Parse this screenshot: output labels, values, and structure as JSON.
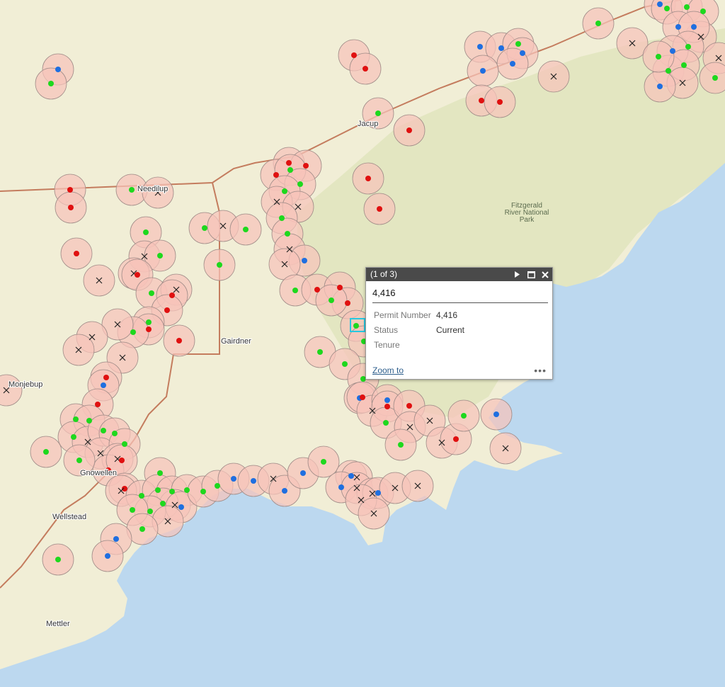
{
  "map": {
    "place_labels": [
      "Jacup",
      "Needilup",
      "Gairdner",
      "Monjebup",
      "Gnowellen",
      "Wellstead",
      "Mettler"
    ],
    "park_label_lines": [
      "Fitzgerald",
      "River National",
      "Park"
    ],
    "marker_colors": {
      "green": "#1ed81e",
      "blue": "#1f6fe0",
      "red": "#e01010",
      "cross": "#222222",
      "buffer_fill": "#f6c4ba",
      "road": "#c47c5e",
      "ocean": "#bcd8ef",
      "land": "#f1eed6",
      "park": "#e3e6c1"
    }
  },
  "popup": {
    "counter": "(1 of 3)",
    "title": "4,416",
    "fields": [
      {
        "name": "Permit Number",
        "value": "4,416"
      },
      {
        "name": "Status",
        "value": "Current"
      },
      {
        "name": "Tenure",
        "value": ""
      }
    ],
    "zoom_link": "Zoom to",
    "more_label": "•••",
    "icons": [
      "next-arrow-icon",
      "maximize-icon",
      "close-icon"
    ]
  }
}
